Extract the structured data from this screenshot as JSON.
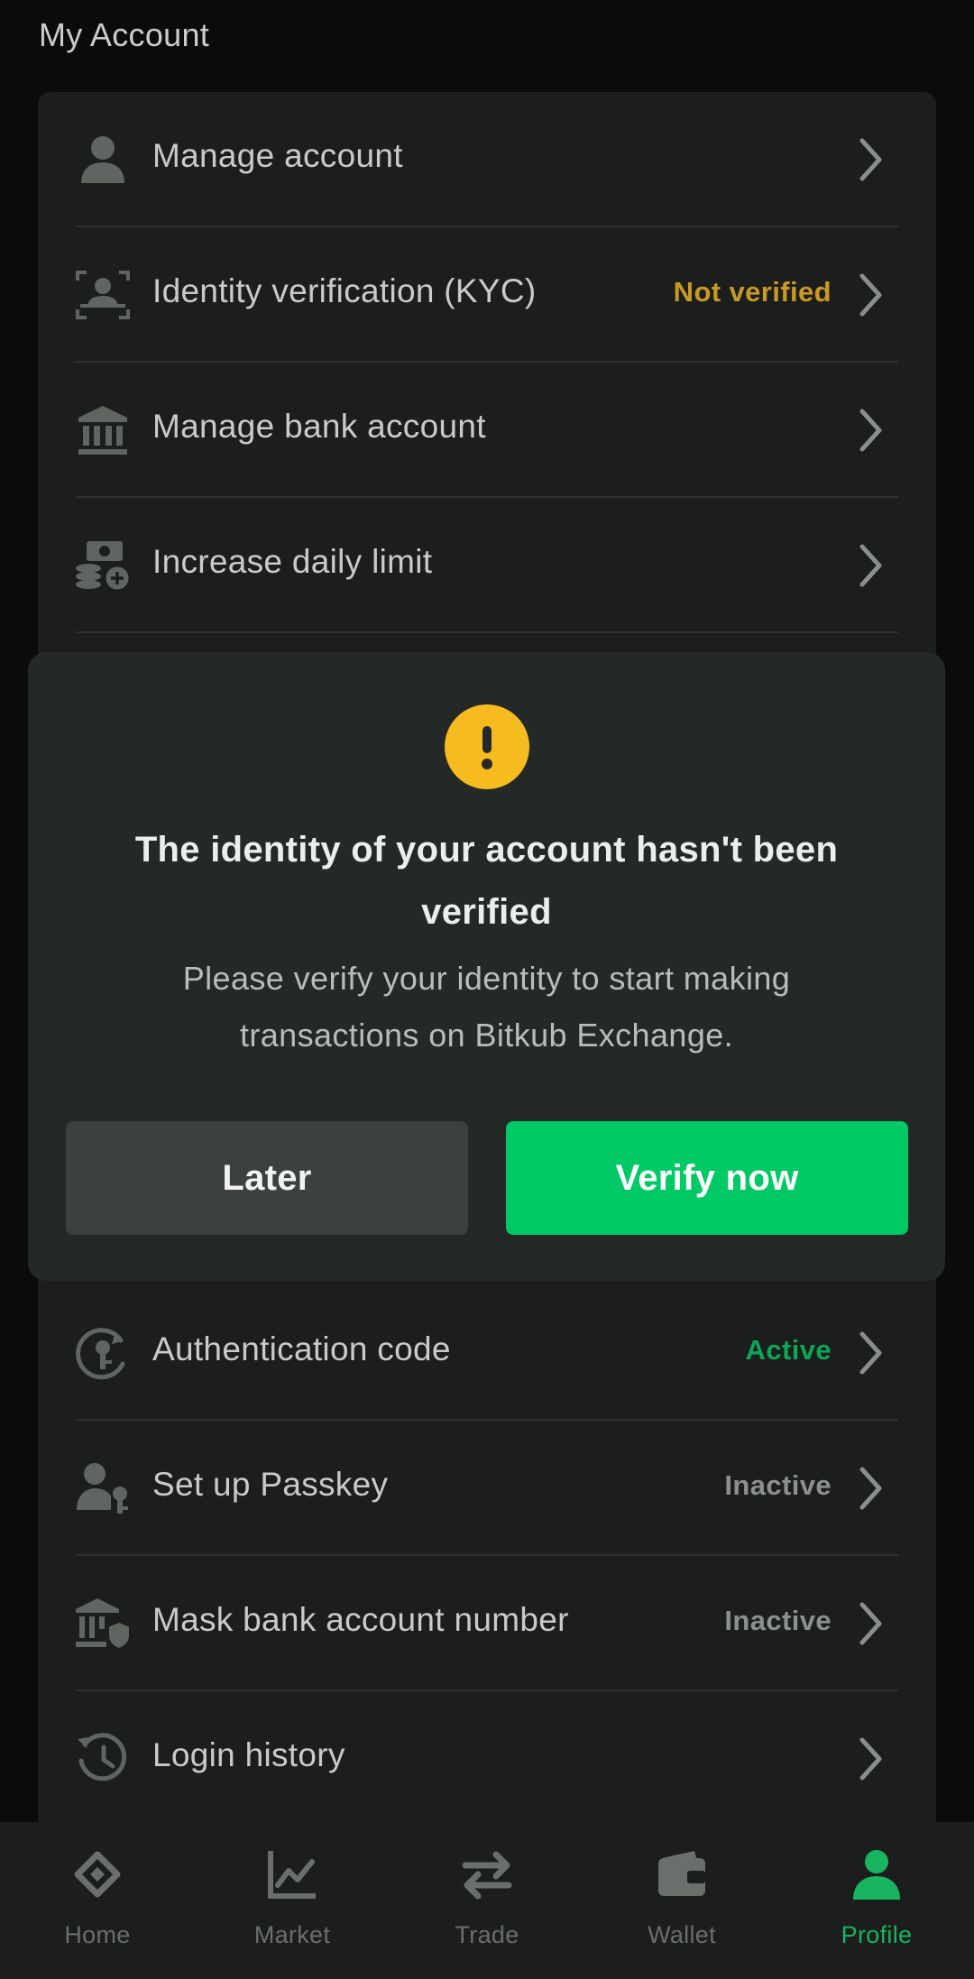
{
  "page": {
    "title": "My Account"
  },
  "colors": {
    "background": "#0a0b0a",
    "card": "#1b1e1c",
    "warning": "#c89a25",
    "active": "#10a556",
    "inactive": "#8c918d",
    "primary_button": "#00c965",
    "alert_badge": "#f6bb1f"
  },
  "menu": {
    "items": [
      {
        "label": "Manage account",
        "status": "",
        "icon": "user-icon"
      },
      {
        "label": "Identity verification (KYC)",
        "status": "Not verified",
        "icon": "face-scan-icon"
      },
      {
        "label": "Manage bank account",
        "status": "",
        "icon": "bank-icon"
      },
      {
        "label": "Increase daily limit",
        "status": "",
        "icon": "money-plus-icon"
      },
      {
        "label": "Authentication code",
        "status": "Active",
        "icon": "key-refresh-icon"
      },
      {
        "label": "Set up Passkey",
        "status": "Inactive",
        "icon": "user-key-icon"
      },
      {
        "label": "Mask bank account number",
        "status": "Inactive",
        "icon": "bank-shield-icon"
      },
      {
        "label": "Login history",
        "status": "",
        "icon": "history-icon"
      }
    ]
  },
  "modal": {
    "icon": "exclamation-icon",
    "title": "The identity of your account hasn't been verified",
    "body": "Please verify your identity to start making transactions on Bitkub Exchange.",
    "later_label": "Later",
    "verify_label": "Verify now"
  },
  "nav": {
    "items": [
      {
        "label": "Home",
        "icon": "home-icon"
      },
      {
        "label": "Market",
        "icon": "chart-icon"
      },
      {
        "label": "Trade",
        "icon": "swap-icon"
      },
      {
        "label": "Wallet",
        "icon": "wallet-icon"
      },
      {
        "label": "Profile",
        "icon": "profile-icon",
        "active": true
      }
    ]
  }
}
